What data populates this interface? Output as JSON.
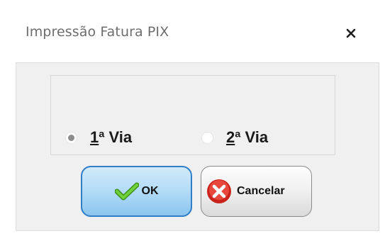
{
  "window": {
    "title": "Impressão Fatura PIX",
    "close_symbol": "×"
  },
  "radio_options": [
    {
      "accel": "1",
      "rest": "ª Via",
      "selected": true
    },
    {
      "accel": "2",
      "rest": "ª Via",
      "selected": false
    }
  ],
  "buttons": {
    "ok_label": "OK",
    "ok_icon": "checkmark-icon",
    "cancel_label": "Cancelar",
    "cancel_icon": "red-x-circle-icon"
  },
  "colors": {
    "ok_border": "#2f7ec7",
    "ok_fill": "#b2dbf7",
    "cancel_icon": "#d9342b",
    "check_green": "#5fc12e"
  }
}
